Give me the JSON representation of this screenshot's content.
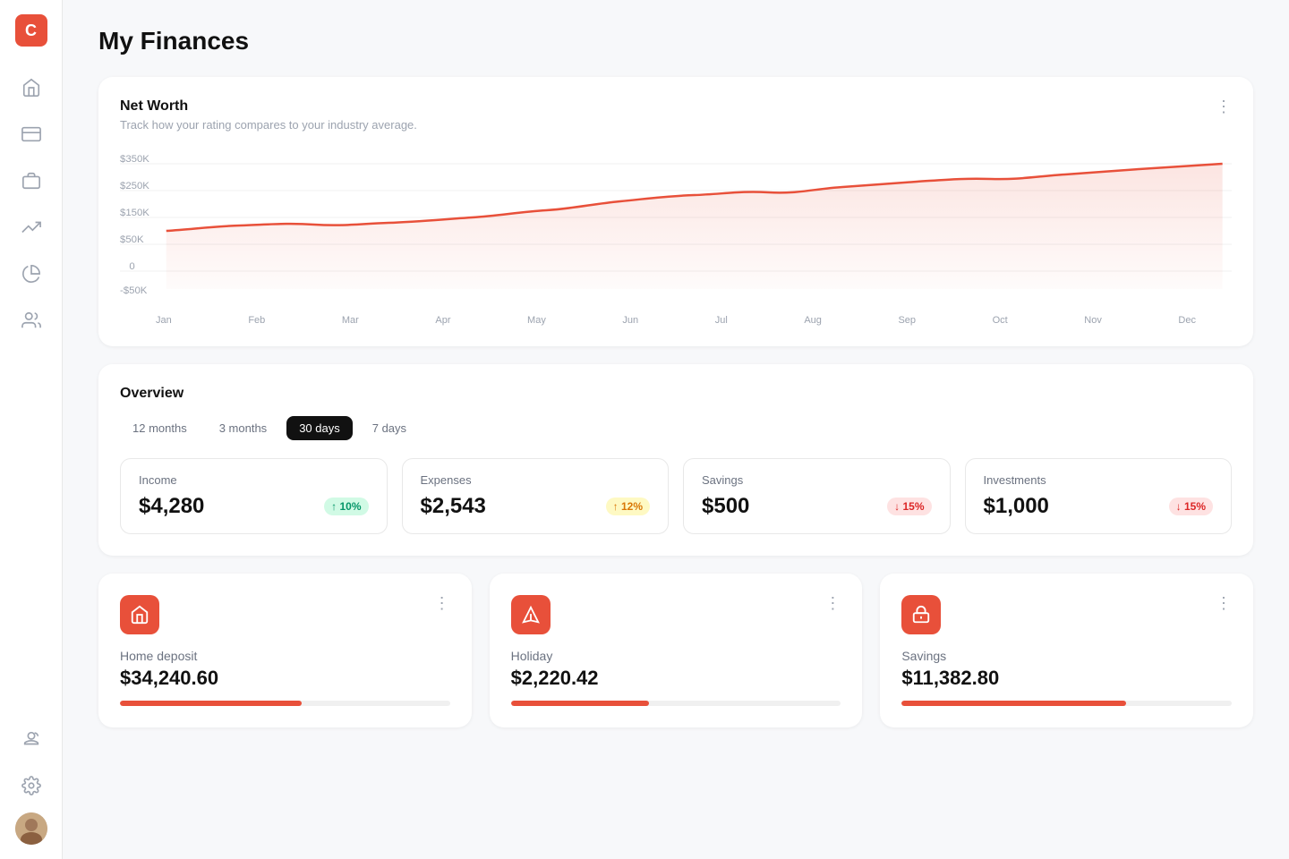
{
  "app": {
    "logo": "C",
    "page_title": "My Finances"
  },
  "sidebar": {
    "items": [
      {
        "name": "home",
        "icon": "home"
      },
      {
        "name": "cards",
        "icon": "credit-card"
      },
      {
        "name": "portfolio",
        "icon": "briefcase"
      },
      {
        "name": "trending",
        "icon": "trending-up"
      },
      {
        "name": "reports",
        "icon": "pie-chart"
      },
      {
        "name": "users",
        "icon": "users"
      }
    ]
  },
  "net_worth_chart": {
    "title": "Net Worth",
    "subtitle": "Track how your rating compares to your industry average.",
    "y_labels": [
      "$350K",
      "$250K",
      "$150K",
      "$50K",
      "0",
      "-$50K"
    ],
    "x_labels": [
      "Jan",
      "Feb",
      "Mar",
      "Apr",
      "May",
      "Jun",
      "Jul",
      "Aug",
      "Sep",
      "Oct",
      "Nov",
      "Dec"
    ],
    "more_icon": "⋮"
  },
  "overview": {
    "title": "Overview",
    "tabs": [
      {
        "label": "12 months",
        "active": false
      },
      {
        "label": "3 months",
        "active": false
      },
      {
        "label": "30 days",
        "active": true
      },
      {
        "label": "7 days",
        "active": false
      }
    ],
    "metrics": [
      {
        "label": "Income",
        "value": "$4,280",
        "badge": "↑ 10%",
        "badge_type": "green"
      },
      {
        "label": "Expenses",
        "value": "$2,543",
        "badge": "↑ 12%",
        "badge_type": "yellow"
      },
      {
        "label": "Savings",
        "value": "$500",
        "badge": "↓ 15%",
        "badge_type": "red"
      },
      {
        "label": "Investments",
        "value": "$1,000",
        "badge": "↓ 15%",
        "badge_type": "red"
      }
    ]
  },
  "goals": [
    {
      "name": "Home deposit",
      "amount": "$34,240.60",
      "progress": 55,
      "icon": "house"
    },
    {
      "name": "Holiday",
      "amount": "$2,220.42",
      "progress": 42,
      "icon": "plane"
    },
    {
      "name": "Savings",
      "amount": "$11,382.80",
      "progress": 68,
      "icon": "savings"
    }
  ],
  "bottom": {
    "settings_icon": "⚙",
    "admin_icon": "👤"
  }
}
